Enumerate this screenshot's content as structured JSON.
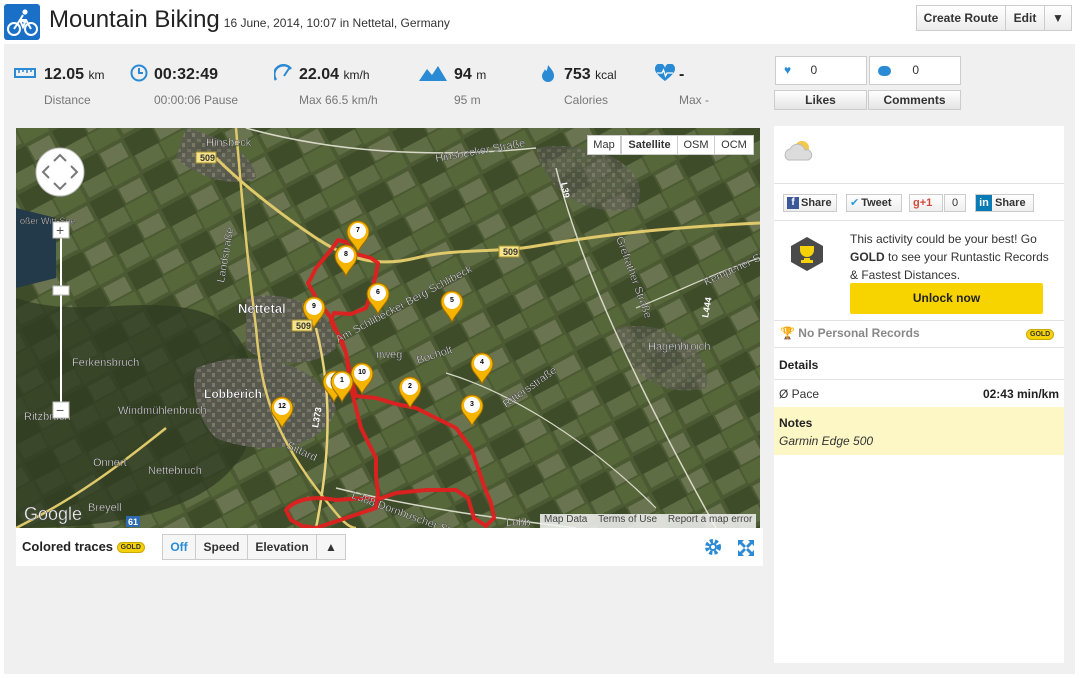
{
  "header": {
    "title": "Mountain Biking",
    "subtitle": "16 June, 2014, 10:07 in Nettetal, Germany",
    "create_route": "Create Route",
    "edit": "Edit"
  },
  "stats": [
    {
      "icon": "ruler-icon",
      "value": "12.05",
      "unit": "km",
      "label": "Distance"
    },
    {
      "icon": "clock-icon",
      "value": "00:32:49",
      "unit": "",
      "label": "00:00:06 Pause"
    },
    {
      "icon": "speedometer-icon",
      "value": "22.04",
      "unit": "km/h",
      "label": "Max 66.5 km/h"
    },
    {
      "icon": "mountain-icon",
      "value": "94",
      "unit": "m",
      "label": "95 m"
    },
    {
      "icon": "flame-icon",
      "value": "753",
      "unit": "kcal",
      "label": "Calories"
    },
    {
      "icon": "heart-rate-icon",
      "value": "-",
      "unit": "",
      "label": "Max -"
    }
  ],
  "social": {
    "likes_count": "0",
    "comments_count": "0",
    "likes_label": "Likes",
    "comments_label": "Comments"
  },
  "map": {
    "types": [
      "Map",
      "Satellite",
      "OSM",
      "OCM"
    ],
    "active_type": "Satellite",
    "footer": [
      "Map Data",
      "Terms of Use",
      "Report a map error"
    ],
    "google": "Google",
    "zoom_in": "+",
    "zoom_out": "−",
    "labels": {
      "hinsbeck": "Hinsbeck",
      "hinsbecker": "Hinsbecker Straße",
      "nettetal": "Nettetal",
      "lobberich": "Lobberich",
      "ferkensbruch": "Ferkensbruch",
      "ritzbruch": "Ritzbruch",
      "windmuehlenbruch": "Windmühlenbruch",
      "onnert": "Onnert",
      "nettebruch": "Nettebruch",
      "breyell": "Breyell",
      "hagenbroich": "Hagenbroich",
      "schlibeck": "Am Schlibecker Berg  Schlibeck",
      "bocholt": "Bocholt",
      "rittersstrasse": "Rittersstraße",
      "dornbuscher": "L388 Dornbuscher Straße",
      "landstrasse": "Landstraße",
      "sittard": "Sittard",
      "grefrather": "Grefrather Straße",
      "kempener": "Kempener Str",
      "weg": "nweg",
      "b509_a": "509",
      "b509_b": "509",
      "b509_c": "509",
      "l373_a": "L373",
      "l39": "L39",
      "l444": "L444",
      "b61": "61",
      "lobb": "Lobb",
      "grosser_witt": "oßer\nWitt-See"
    },
    "markers": [
      "12",
      "11",
      "10",
      "9",
      "8",
      "7",
      "6",
      "5",
      "4",
      "3",
      "2",
      "1"
    ]
  },
  "traces": {
    "label": "Colored traces",
    "gold": "GOLD",
    "off": "Off",
    "speed": "Speed",
    "elevation": "Elevation"
  },
  "right": {
    "share": {
      "facebook": "Share",
      "twitter": "Tweet",
      "gplus": "+1",
      "gplus_count": "0",
      "linkedin": "Share"
    },
    "promo_text_1": "This activity could be your best! Go ",
    "promo_gold": "GOLD",
    "promo_text_2": " to see your Runtastic Records & Fastest Distances.",
    "unlock": "Unlock now",
    "no_records": "No Personal Records",
    "gold": "GOLD",
    "details_heading": "Details",
    "pace_label": "Ø Pace",
    "pace_value": "02:43 min/km",
    "notes_heading": "Notes",
    "notes_value": "Garmin Edge 500"
  },
  "colors": {
    "accent": "#2a8ad4",
    "route": "#e02020",
    "gold": "#f5d10a",
    "notes_bg": "#fdf7c6"
  }
}
